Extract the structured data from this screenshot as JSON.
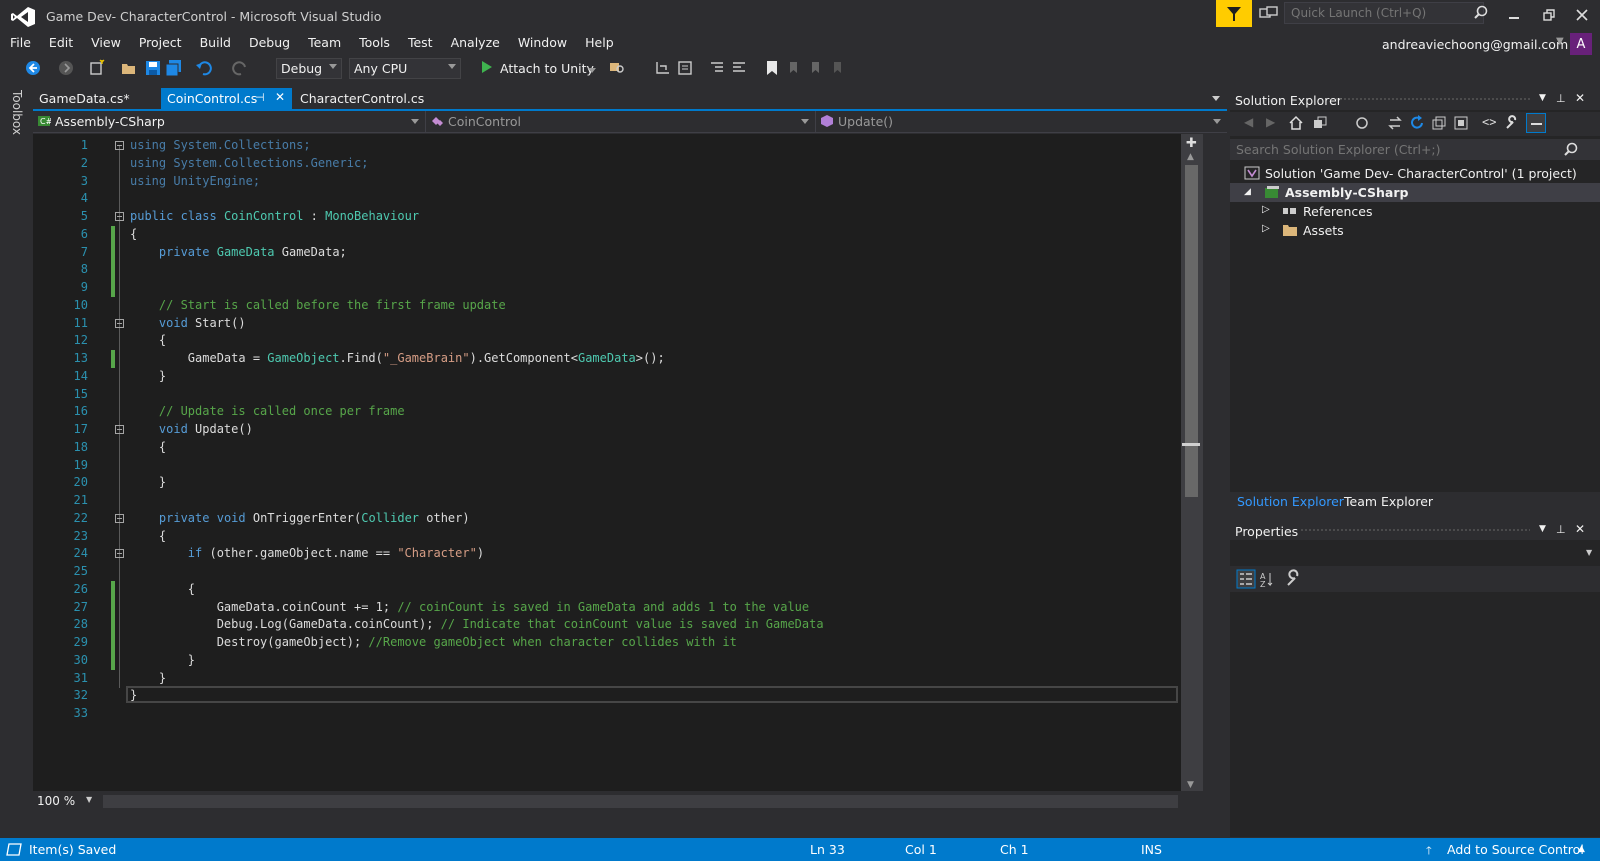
{
  "window": {
    "title": "Game Dev- CharacterControl - Microsoft Visual Studio",
    "quick_launch_placeholder": "Quick Launch (Ctrl+Q)",
    "account_email": "andreaviechoong@gmail.com",
    "account_initial": "A"
  },
  "menu": [
    "File",
    "Edit",
    "View",
    "Project",
    "Build",
    "Debug",
    "Team",
    "Tools",
    "Test",
    "Analyze",
    "Window",
    "Help"
  ],
  "toolbar": {
    "configuration": "Debug",
    "platform": "Any CPU",
    "attach_label": "Attach to Unity"
  },
  "toolbox_label": "Toolbox",
  "tabs": [
    {
      "label": "GameData.cs*",
      "active": false
    },
    {
      "label": "CoinControl.cs",
      "active": true
    },
    {
      "label": "CharacterControl.cs",
      "active": false
    }
  ],
  "nav": {
    "project": "Assembly-CSharp",
    "class": "CoinControl",
    "member": "Update()"
  },
  "code_lines": [
    {
      "n": "1",
      "text": "using System.Collections;"
    },
    {
      "n": "2",
      "text": "using System.Collections.Generic;"
    },
    {
      "n": "3",
      "text": "using UnityEngine;"
    },
    {
      "n": "4",
      "text": ""
    },
    {
      "n": "5",
      "text": "public class CoinControl : MonoBehaviour"
    },
    {
      "n": "6",
      "text": "{"
    },
    {
      "n": "7",
      "text": "    private GameData GameData;"
    },
    {
      "n": "8",
      "text": ""
    },
    {
      "n": "9",
      "text": ""
    },
    {
      "n": "10",
      "text": "    // Start is called before the first frame update"
    },
    {
      "n": "11",
      "text": "    void Start()"
    },
    {
      "n": "12",
      "text": "    {"
    },
    {
      "n": "13",
      "text": "        GameData = GameObject.Find(\"_GameBrain\").GetComponent<GameData>();"
    },
    {
      "n": "14",
      "text": "    }"
    },
    {
      "n": "15",
      "text": ""
    },
    {
      "n": "16",
      "text": "    // Update is called once per frame"
    },
    {
      "n": "17",
      "text": "    void Update()"
    },
    {
      "n": "18",
      "text": "    {"
    },
    {
      "n": "19",
      "text": ""
    },
    {
      "n": "20",
      "text": "    }"
    },
    {
      "n": "21",
      "text": ""
    },
    {
      "n": "22",
      "text": "    private void OnTriggerEnter(Collider other)"
    },
    {
      "n": "23",
      "text": "    {"
    },
    {
      "n": "24",
      "text": "        if (other.gameObject.name == \"Character\")"
    },
    {
      "n": "25",
      "text": ""
    },
    {
      "n": "26",
      "text": "        {"
    },
    {
      "n": "27",
      "text": "            GameData.coinCount += 1; // coinCount is saved in GameData and adds 1 to the value"
    },
    {
      "n": "28",
      "text": "            Debug.Log(GameData.coinCount); // Indicate that coinCount value is saved in GameData"
    },
    {
      "n": "29",
      "text": "            Destroy(gameObject); //Remove gameObject when character collides with it"
    },
    {
      "n": "30",
      "text": "        }"
    },
    {
      "n": "31",
      "text": "    }"
    },
    {
      "n": "32",
      "text": "}"
    },
    {
      "n": "33",
      "text": ""
    }
  ],
  "zoom": "100 %",
  "solution_explorer": {
    "title": "Solution Explorer",
    "search_placeholder": "Search Solution Explorer (Ctrl+;)",
    "solution_label": "Solution 'Game Dev- CharacterControl' (1 project)",
    "project_label": "Assembly-CSharp",
    "references_label": "References",
    "assets_label": "Assets",
    "tab_solution": "Solution Explorer",
    "tab_team": "Team Explorer"
  },
  "properties": {
    "title": "Properties"
  },
  "status": {
    "message": "Item(s) Saved",
    "line": "Ln 33",
    "col": "Col 1",
    "ch": "Ch 1",
    "mode": "INS",
    "source_control": "Add to Source Control"
  },
  "colors": {
    "accent": "#007acc",
    "filter_yellow": "#ffcc00",
    "avatar": "#68217a",
    "editor_bg": "#1e1e1e",
    "keyword": "#569cd6",
    "type": "#4ec9b0",
    "comment": "#57a64a",
    "string": "#d69d85"
  }
}
